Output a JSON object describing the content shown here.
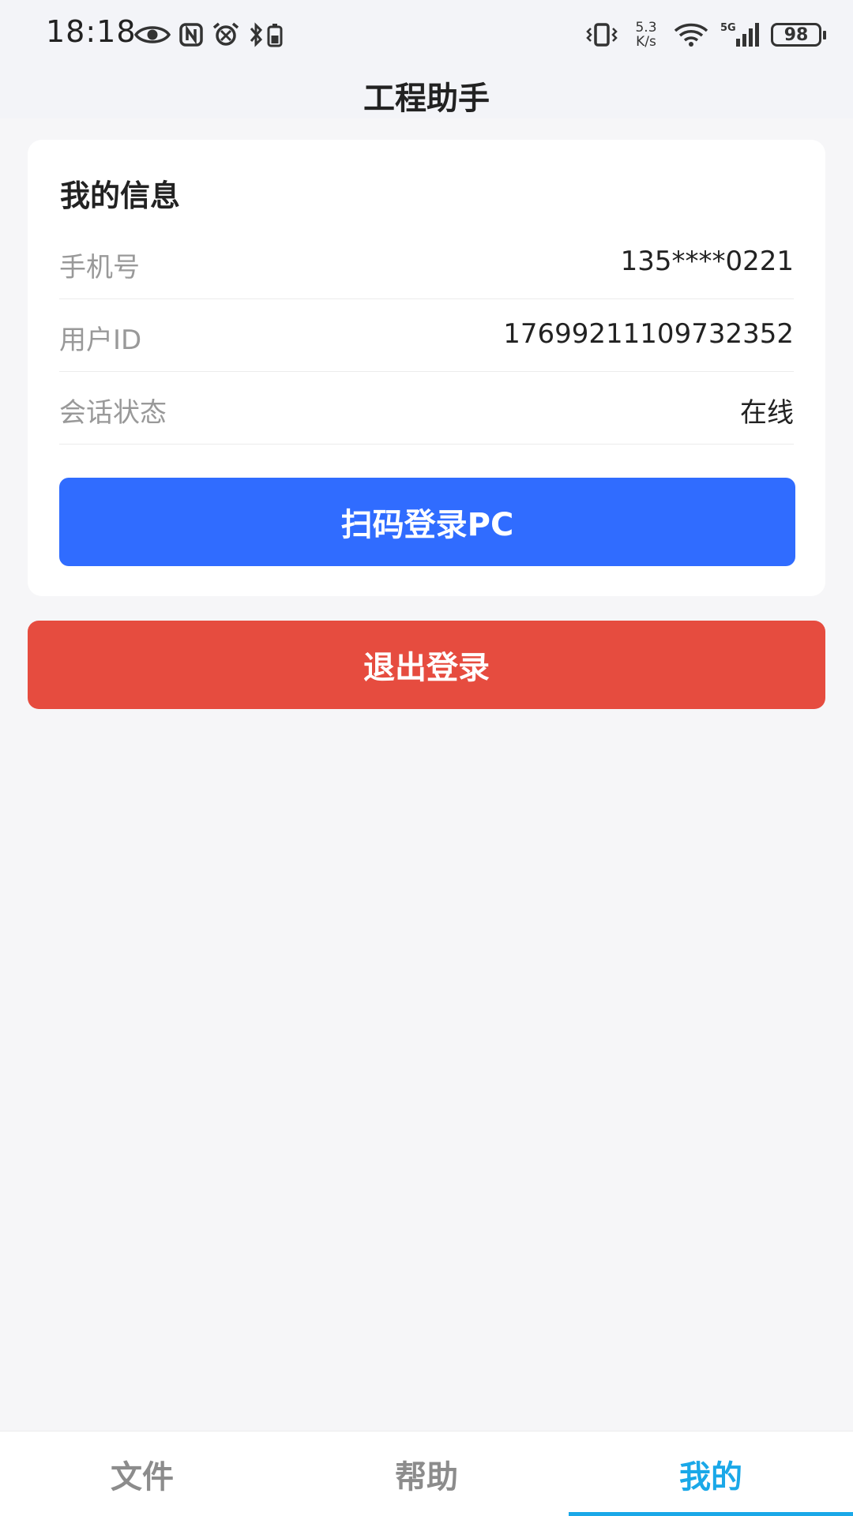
{
  "status_bar": {
    "time": "18:18",
    "net_speed_value": "5.3",
    "net_speed_unit": "K/s",
    "network_type": "5G",
    "battery": "98",
    "left_icons": [
      "eye-icon",
      "nfc-icon",
      "alarm-icon",
      "bluetooth-battery-icon"
    ],
    "right_icons": [
      "vibrate-icon",
      "wifi-icon",
      "signal-icon",
      "battery-icon"
    ]
  },
  "header": {
    "title": "工程助手"
  },
  "info_card": {
    "title": "我的信息",
    "rows": [
      {
        "label": "手机号",
        "value": "135****0221"
      },
      {
        "label": "用户ID",
        "value": "17699211109732352"
      },
      {
        "label": "会话状态",
        "value": "在线"
      }
    ],
    "scan_button_label": "扫码登录PC"
  },
  "logout_button_label": "退出登录",
  "bottom_nav": {
    "tabs": [
      {
        "label": "文件",
        "active": false
      },
      {
        "label": "帮助",
        "active": false
      },
      {
        "label": "我的",
        "active": true
      }
    ]
  },
  "colors": {
    "primary_blue": "#306cff",
    "danger_red": "#e64c3f",
    "active_tab": "#1aa8e8",
    "background": "#f6f6f8"
  }
}
